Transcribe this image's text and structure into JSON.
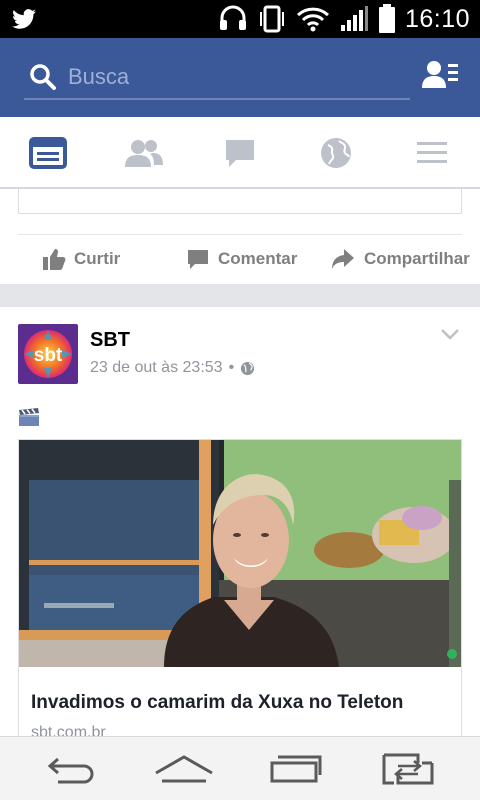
{
  "status_bar": {
    "time": "16:10",
    "icons": [
      "twitter-icon",
      "headset-icon",
      "vibrate-icon",
      "wifi-icon",
      "signal-icon",
      "battery-icon"
    ]
  },
  "header": {
    "search_placeholder": "Busca",
    "icons": [
      "search-icon",
      "friend-requests-icon"
    ],
    "background": "#3b5998"
  },
  "tabs": [
    {
      "name": "news-feed",
      "icon": "news-feed-icon",
      "active": true
    },
    {
      "name": "friends",
      "icon": "friends-icon",
      "active": false
    },
    {
      "name": "messages",
      "icon": "chat-icon",
      "active": false
    },
    {
      "name": "notifications",
      "icon": "globe-icon",
      "active": false
    },
    {
      "name": "more",
      "icon": "menu-icon",
      "active": false
    }
  ],
  "previous_post_actions": {
    "like": "Curtir",
    "comment": "Comentar",
    "share": "Compartilhar"
  },
  "post": {
    "author": "SBT",
    "avatar_text": "sbt",
    "timestamp": "23 de out às 23:53",
    "separator": "•",
    "privacy": "globe-icon",
    "attachment_icon": "clapperboard-icon",
    "link": {
      "title": "Invadimos o camarim da Xuxa no Teleton",
      "domain": "sbt.com.br"
    }
  },
  "nav_bar": {
    "buttons": [
      "back-icon",
      "home-icon",
      "recents-icon",
      "switch-apps-icon"
    ]
  },
  "colors": {
    "accent": "#3b5998",
    "muted_text": "#90949c",
    "action_text": "#7f7f7f",
    "active_tab": "#3b5998",
    "inactive_tab": "#bdc1c9"
  }
}
